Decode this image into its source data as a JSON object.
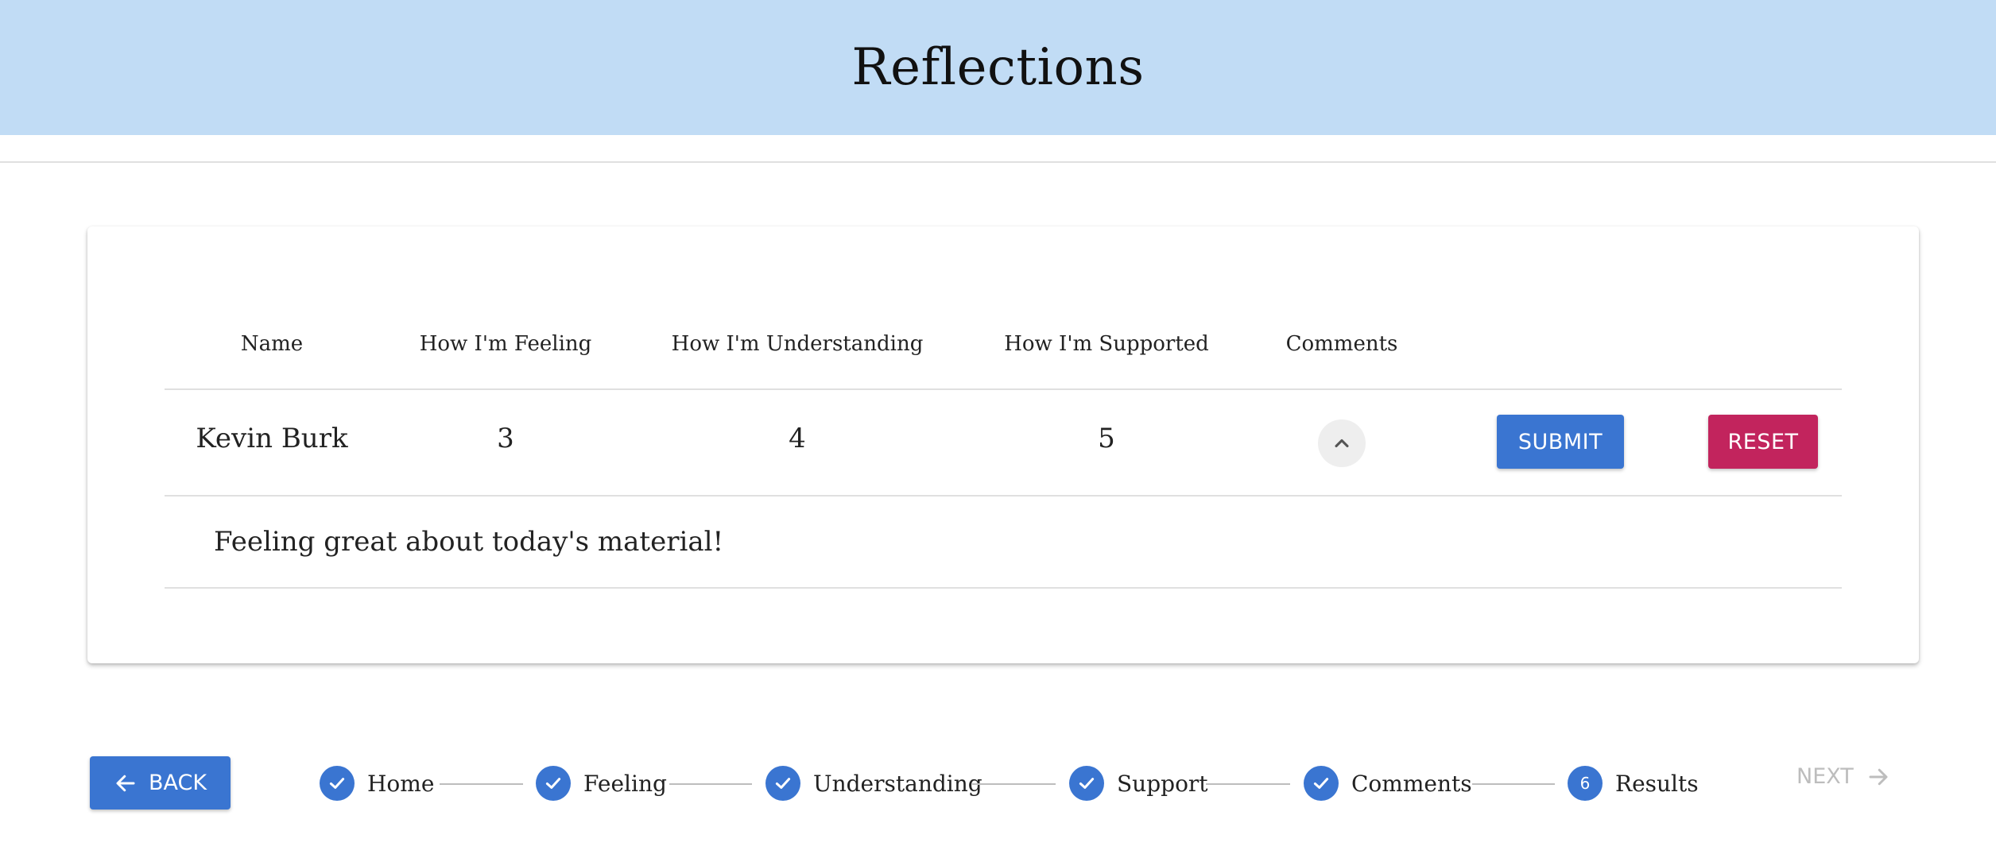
{
  "header": {
    "title": "Reflections"
  },
  "table": {
    "columns": [
      "Name",
      "How I'm Feeling",
      "How I'm Understanding",
      "How I'm Supported",
      "Comments"
    ],
    "row": {
      "name": "Kevin Burk",
      "feeling": "3",
      "understanding": "4",
      "supported": "5"
    },
    "comment": "Feeling great about today's material!",
    "submit_label": "SUBMIT",
    "reset_label": "RESET"
  },
  "footer": {
    "back_label": "BACK",
    "next_label": "NEXT",
    "steps": [
      {
        "label": "Home",
        "state": "complete"
      },
      {
        "label": "Feeling",
        "state": "complete"
      },
      {
        "label": "Understanding",
        "state": "complete"
      },
      {
        "label": "Support",
        "state": "complete"
      },
      {
        "label": "Comments",
        "state": "complete"
      },
      {
        "label": "Results",
        "state": "active",
        "number": "6"
      }
    ]
  },
  "colors": {
    "header_bg": "#c1dcf5",
    "primary": "#3a75d1",
    "secondary": "#c2245d",
    "disabled": "#bdbdbd"
  },
  "icons": {
    "expand": "chevron-up-icon",
    "step_done": "check-icon",
    "back": "arrow-left-icon",
    "next": "arrow-right-icon"
  }
}
